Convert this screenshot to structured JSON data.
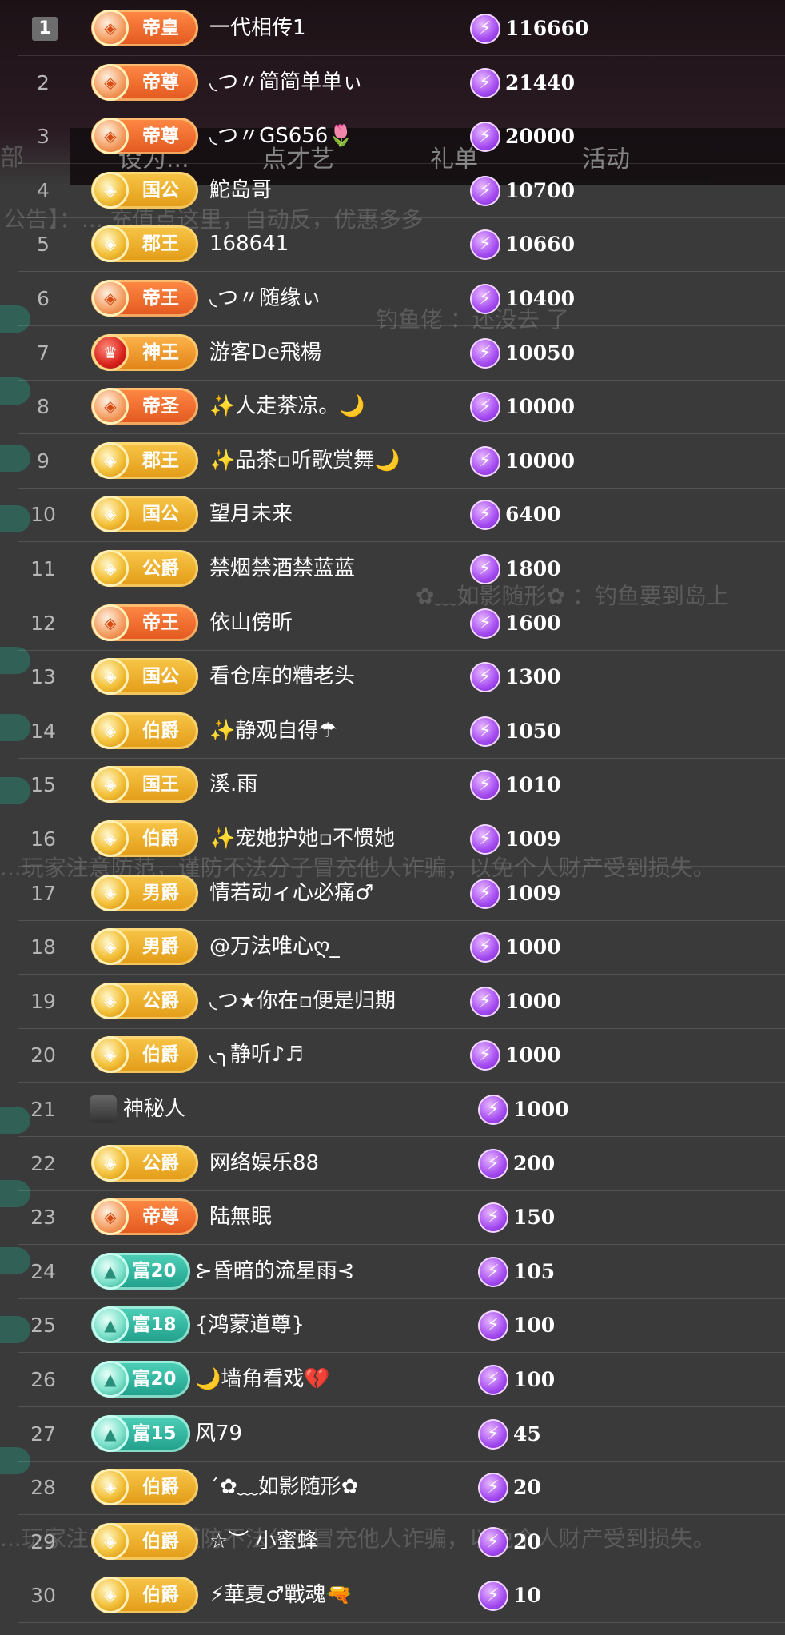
{
  "backdrop": {
    "nav": [
      "部",
      "设为...",
      "点才艺",
      "礼单",
      "活动"
    ],
    "notice": "公告】：... 充值点这里，自动反，优惠多多",
    "warning": "...玩家注意防范，谨防不法分子冒充他人诈骗，以免个人财产受到损失。",
    "chat_1": "钓鱼佬 ：还没去 了",
    "chat_2": "✿﹏如影随形✿ ：钓鱼要到岛上"
  },
  "ranking": [
    {
      "rank": "1",
      "badge": "帝皇",
      "style": "orange",
      "name": "一代相传1",
      "score": "116660"
    },
    {
      "rank": "2",
      "badge": "帝尊",
      "style": "orange",
      "name": "◟つ〃简简单单ぃ",
      "score": "21440"
    },
    {
      "rank": "3",
      "badge": "帝尊",
      "style": "orange",
      "name": "◟つ〃GS656🌷",
      "score": "20000"
    },
    {
      "rank": "4",
      "badge": "国公",
      "style": "gold",
      "name": "鮀岛哥",
      "score": "10700"
    },
    {
      "rank": "5",
      "badge": "郡王",
      "style": "gold",
      "name": "168641",
      "score": "10660"
    },
    {
      "rank": "6",
      "badge": "帝王",
      "style": "orange",
      "name": "◟つ〃随缘ぃ",
      "score": "10400"
    },
    {
      "rank": "7",
      "badge": "神王",
      "style": "red",
      "name": "游客De飛楊",
      "score": "10050"
    },
    {
      "rank": "8",
      "badge": "帝圣",
      "style": "orange",
      "name": "✨人走茶凉。🌙",
      "score": "10000"
    },
    {
      "rank": "9",
      "badge": "郡王",
      "style": "gold",
      "name": "✨品茶▫听歌赏舞🌙",
      "score": "10000"
    },
    {
      "rank": "10",
      "badge": "国公",
      "style": "gold",
      "name": "望月未来",
      "score": "6400"
    },
    {
      "rank": "11",
      "badge": "公爵",
      "style": "gold",
      "name": "禁烟禁酒禁蓝蓝",
      "score": "1800"
    },
    {
      "rank": "12",
      "badge": "帝王",
      "style": "orange",
      "name": "依山傍昕",
      "score": "1600"
    },
    {
      "rank": "13",
      "badge": "国公",
      "style": "gold",
      "name": "看仓库的糟老头",
      "score": "1300"
    },
    {
      "rank": "14",
      "badge": "伯爵",
      "style": "gold",
      "name": "✨静观自得☂",
      "score": "1050"
    },
    {
      "rank": "15",
      "badge": "国王",
      "style": "gold",
      "name": "溪.雨",
      "score": "1010"
    },
    {
      "rank": "16",
      "badge": "伯爵",
      "style": "gold",
      "name": "✨宠她护她▫不惯她",
      "score": "1009"
    },
    {
      "rank": "17",
      "badge": "男爵",
      "style": "gold",
      "name": "情若动ィ心必痛♂",
      "score": "1009"
    },
    {
      "rank": "18",
      "badge": "男爵",
      "style": "gold",
      "name": "@万法唯心ღ_",
      "score": "1000"
    },
    {
      "rank": "19",
      "badge": "公爵",
      "style": "gold",
      "name": "◟つ★你在▫便是归期",
      "score": "1000"
    },
    {
      "rank": "20",
      "badge": "伯爵",
      "style": "gold",
      "name": "◟╮静听♪♬",
      "score": "1000"
    },
    {
      "rank": "21",
      "badge": "",
      "style": "avatar",
      "name": "神秘人",
      "score": "1000"
    },
    {
      "rank": "22",
      "badge": "公爵",
      "style": "gold",
      "name": "网络娱乐88",
      "score": "200"
    },
    {
      "rank": "23",
      "badge": "帝尊",
      "style": "orange",
      "name": "陆無眠",
      "score": "150"
    },
    {
      "rank": "24",
      "badge": "富20",
      "style": "teal",
      "name": "⊱昏暗的流星雨⊰",
      "score": "105"
    },
    {
      "rank": "25",
      "badge": "富18",
      "style": "teal",
      "name": "{鸿蒙道尊}",
      "score": "100"
    },
    {
      "rank": "26",
      "badge": "富20",
      "style": "teal",
      "name": "🌙墙角看戏💔",
      "score": "100"
    },
    {
      "rank": "27",
      "badge": "富15",
      "style": "teal",
      "name": "风79",
      "score": "45"
    },
    {
      "rank": "28",
      "badge": "伯爵",
      "style": "gold",
      "name": "ˊ✿﹏如影随形✿",
      "score": "20"
    },
    {
      "rank": "29",
      "badge": "伯爵",
      "style": "gold",
      "name": "☆︶ 小蜜蜂",
      "score": "20"
    },
    {
      "rank": "30",
      "badge": "伯爵",
      "style": "gold",
      "name": "⚡華夏♂戰魂🔫",
      "score": "10"
    }
  ]
}
